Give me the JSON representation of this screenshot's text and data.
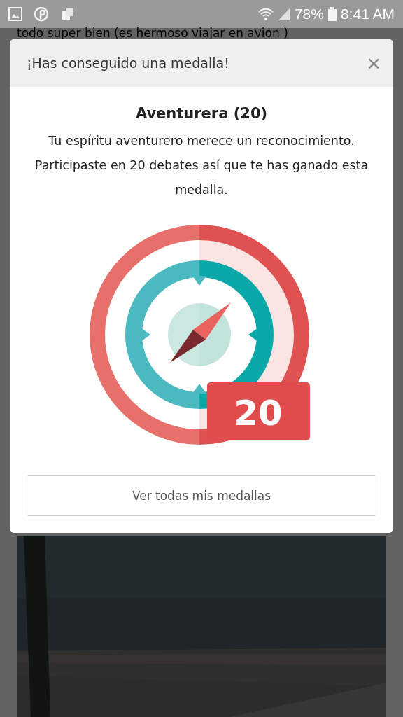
{
  "status_bar": {
    "battery": "78%",
    "time": "8:41 AM"
  },
  "post": {
    "text": "todo super bien (es hermoso viajar en avion )"
  },
  "dialog": {
    "title": "¡Has conseguido una medalla!",
    "close": "×",
    "medal_name": "Aventurera (20)",
    "description": "Tu espíritu aventurero merece un reconocimiento. Participaste en 20 debates así que te has ganado esta medalla.",
    "badge_count": "20",
    "button": "Ver todas mis medallas"
  }
}
